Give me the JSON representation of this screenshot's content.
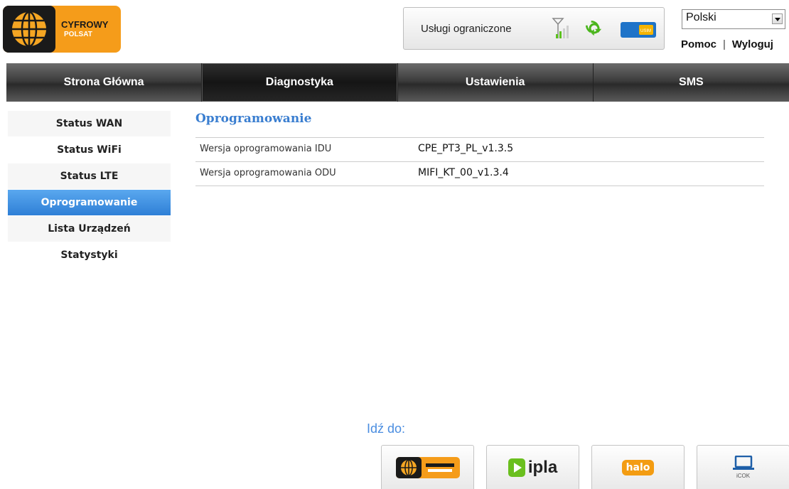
{
  "header": {
    "brand_text_line1": "CYFROWY",
    "brand_text_line2": "POLSAT",
    "status_text": "Usługi ograniczone",
    "usim_label": "USIM",
    "language": {
      "selected": "Polski"
    },
    "help_label": "Pomoc",
    "separator": "|",
    "logout_label": "Wyloguj"
  },
  "nav": {
    "tabs": [
      {
        "label": "Strona Główna"
      },
      {
        "label": "Diagnostyka"
      },
      {
        "label": "Ustawienia"
      },
      {
        "label": "SMS"
      }
    ]
  },
  "sidebar": {
    "items": [
      {
        "label": "Status WAN"
      },
      {
        "label": "Status WiFi"
      },
      {
        "label": "Status LTE"
      },
      {
        "label": "Oprogramowanie"
      },
      {
        "label": "Lista Urządzeń"
      },
      {
        "label": "Statystyki"
      }
    ]
  },
  "main": {
    "title": "Oprogramowanie",
    "rows": [
      {
        "label": "Wersja oprogramowania IDU",
        "value": "CPE_PT3_PL_v1.3.5"
      },
      {
        "label": "Wersja oprogramowania ODU",
        "value": "MIFI_KT_00_v1.3.4"
      }
    ]
  },
  "footer": {
    "goto_label": "Idź do:",
    "links": {
      "ipla": "ipla",
      "halo": "halo",
      "icok": "iCOK"
    }
  },
  "colors": {
    "accent": "#3a7ed0",
    "active_side": "#2e7fd6",
    "brand_orange": "#f39c12"
  }
}
